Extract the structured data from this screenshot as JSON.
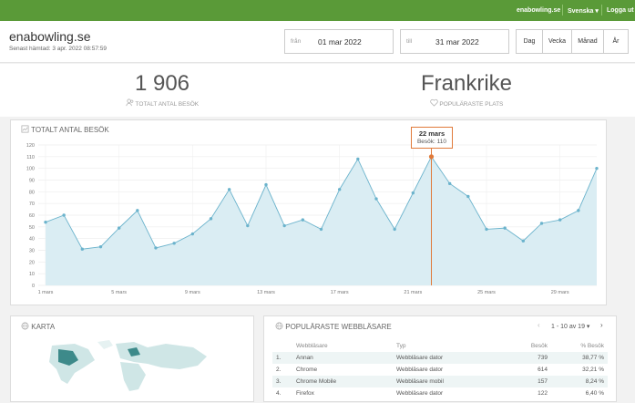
{
  "topbar": {
    "site": "enabowling.se",
    "language": "Svenska",
    "logout": "Logga ut"
  },
  "header": {
    "title": "enabowling.se",
    "fetched": "Senast hämtad: 3 apr. 2022 08:57:59",
    "from_label": "från",
    "from_value": "01 mar 2022",
    "to_label": "till",
    "to_value": "31 mar 2022",
    "periods": [
      "Dag",
      "Vecka",
      "Månad",
      "År"
    ]
  },
  "stats": {
    "visits_value": "1 906",
    "visits_label": "TOTALT ANTAL BESÖK",
    "place_value": "Frankrike",
    "place_label": "POPULÄRASTE PLATS"
  },
  "visits_panel": {
    "title": "TOTALT ANTAL BESÖK"
  },
  "tooltip": {
    "date": "22 mars",
    "text": "Besök: 110"
  },
  "chart_data": {
    "type": "area",
    "x_ticks": [
      "1 mars",
      "5 mars",
      "9 mars",
      "13 mars",
      "17 mars",
      "21 mars",
      "25 mars",
      "29 mars"
    ],
    "y_ticks": [
      0,
      10,
      20,
      30,
      40,
      50,
      60,
      70,
      80,
      90,
      100,
      110,
      120
    ],
    "ylim": [
      0,
      120
    ],
    "values": [
      54,
      60,
      31,
      33,
      49,
      64,
      32,
      36,
      44,
      57,
      82,
      51,
      86,
      51,
      56,
      48,
      82,
      108,
      74,
      48,
      79,
      110,
      87,
      76,
      48,
      49,
      38,
      53,
      56,
      64,
      100
    ],
    "highlight_index": 21,
    "grid": true,
    "colors": {
      "line": "#6bb3cc",
      "fill": "#daedf3",
      "highlight": "#e07a3a"
    }
  },
  "map_panel": {
    "title": "KARTA"
  },
  "browsers_panel": {
    "title": "POPULÄRASTE WEBBLÄSARE",
    "pager": "1 - 10 av 19",
    "headers": [
      "Webbläsare",
      "Typ",
      "Besök",
      "% Besök"
    ],
    "rows": [
      {
        "n": "1.",
        "name": "Annan",
        "type": "Webbläsare dator",
        "visits": "739",
        "pct": "38,77 %"
      },
      {
        "n": "2.",
        "name": "Chrome",
        "type": "Webbläsare dator",
        "visits": "614",
        "pct": "32,21 %"
      },
      {
        "n": "3.",
        "name": "Chrome Mobile",
        "type": "Webbläsare mobil",
        "visits": "157",
        "pct": "8,24 %"
      },
      {
        "n": "4.",
        "name": "Firefox",
        "type": "Webbläsare dator",
        "visits": "122",
        "pct": "6,40 %"
      }
    ]
  }
}
